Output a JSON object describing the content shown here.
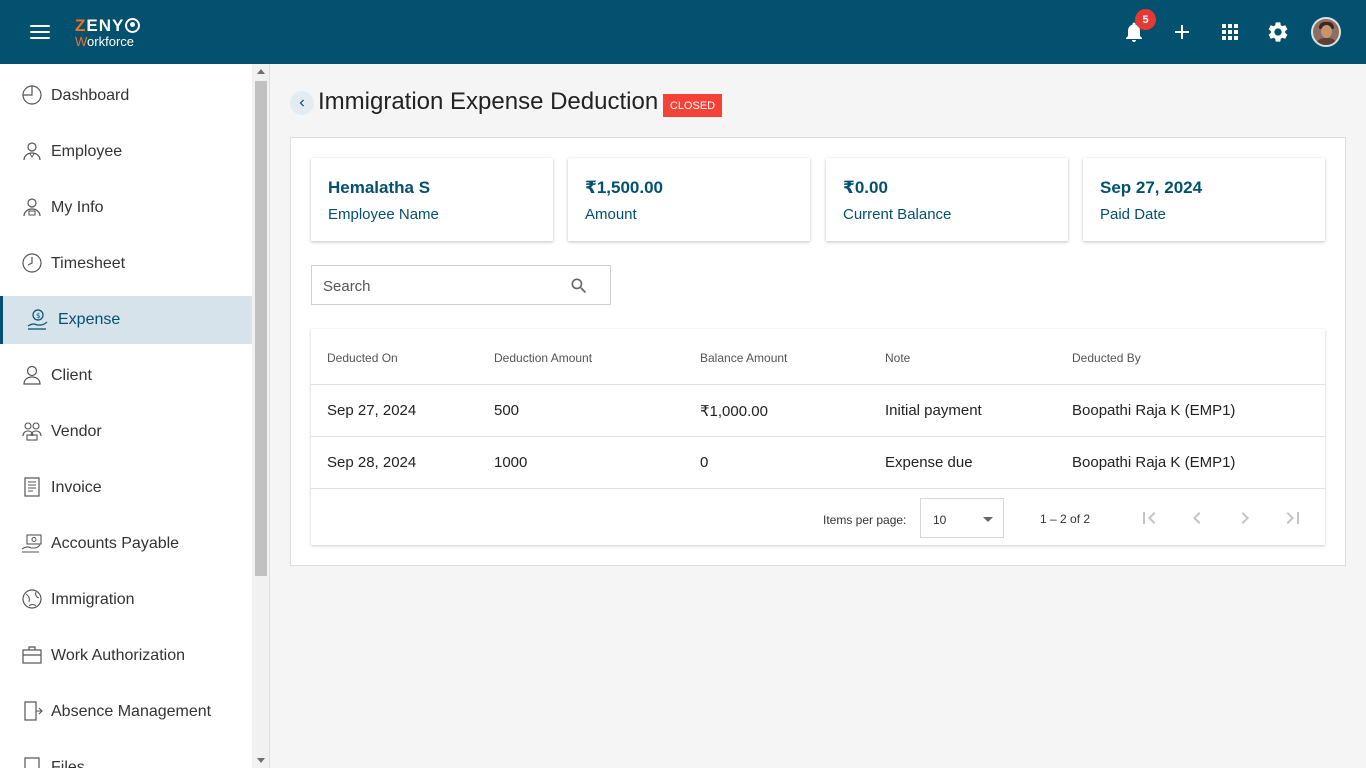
{
  "header": {
    "logo_top": "ZENY",
    "logo_bottom": "Workforce",
    "notification_count": "5",
    "brand_color": "#04506f"
  },
  "sidebar": {
    "items": [
      {
        "label": "Dashboard",
        "icon": "dashboard-icon"
      },
      {
        "label": "Employee",
        "icon": "employee-icon"
      },
      {
        "label": "My Info",
        "icon": "my-info-icon"
      },
      {
        "label": "Timesheet",
        "icon": "clock-icon"
      },
      {
        "label": "Expense",
        "icon": "expense-icon",
        "active": true
      },
      {
        "label": "Client",
        "icon": "client-icon"
      },
      {
        "label": "Vendor",
        "icon": "vendor-icon"
      },
      {
        "label": "Invoice",
        "icon": "invoice-icon"
      },
      {
        "label": "Accounts Payable",
        "icon": "accounts-payable-icon"
      },
      {
        "label": "Immigration",
        "icon": "globe-icon"
      },
      {
        "label": "Work Authorization",
        "icon": "briefcase-icon"
      },
      {
        "label": "Absence Management",
        "icon": "door-icon"
      },
      {
        "label": "Files",
        "icon": "file-icon"
      }
    ]
  },
  "page": {
    "title": "Immigration Expense Deduction",
    "status": "CLOSED",
    "status_color": "#f44336"
  },
  "cards": [
    {
      "value": "Hemalatha S",
      "label": "Employee Name"
    },
    {
      "value": "₹1,500.00",
      "label": "Amount"
    },
    {
      "value": "₹0.00",
      "label": "Current Balance"
    },
    {
      "value": "Sep 27, 2024",
      "label": "Paid Date"
    }
  ],
  "search": {
    "placeholder": "Search",
    "value": ""
  },
  "table": {
    "headers": [
      "Deducted On",
      "Deduction Amount",
      "Balance Amount",
      "Note",
      "Deducted By"
    ],
    "rows": [
      [
        "Sep 27, 2024",
        "500",
        "₹1,000.00",
        "Initial payment",
        "Boopathi Raja K (EMP1)"
      ],
      [
        "Sep 28, 2024",
        "1000",
        "0",
        "Expense due",
        "Boopathi Raja K (EMP1)"
      ]
    ]
  },
  "paginator": {
    "items_per_page_label": "Items per page:",
    "items_per_page": "10",
    "range": "1 – 2 of 2"
  }
}
